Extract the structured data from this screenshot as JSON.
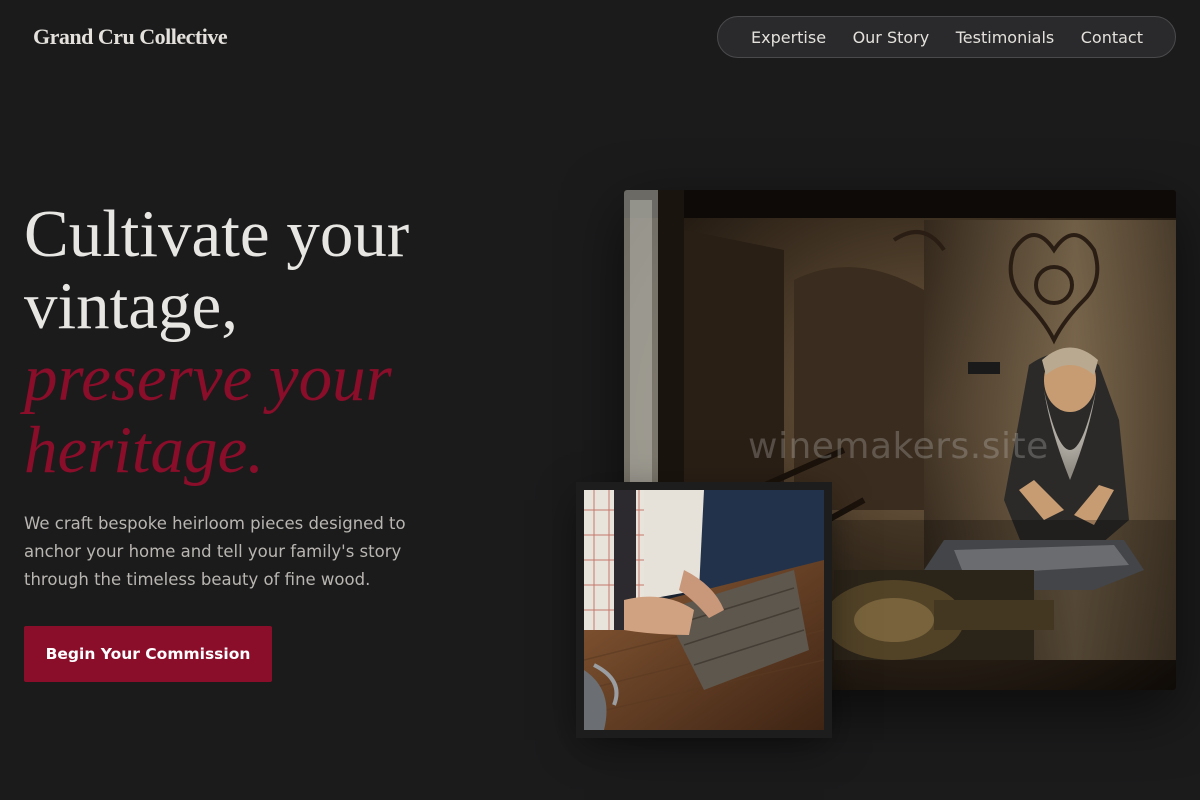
{
  "header": {
    "logo": "Grand Cru Collective",
    "nav": [
      "Expertise",
      "Our Story",
      "Testimonials",
      "Contact"
    ]
  },
  "hero": {
    "headline_line1": "Cultivate your vintage,",
    "headline_line2": "preserve your heritage.",
    "description": "We craft bespoke heirloom pieces designed to anchor your home and tell your family's story through the timeless beauty of fine wood.",
    "cta": "Begin Your Commission"
  },
  "images": {
    "main_icon": "blacksmith-workshop-photo",
    "inset_icon": "craftsman-woodwork-photo"
  },
  "watermark": "winemakers.site",
  "colors": {
    "background": "#1b1b1c",
    "accent": "#8a0d2a",
    "text": "#e8e6e3"
  }
}
